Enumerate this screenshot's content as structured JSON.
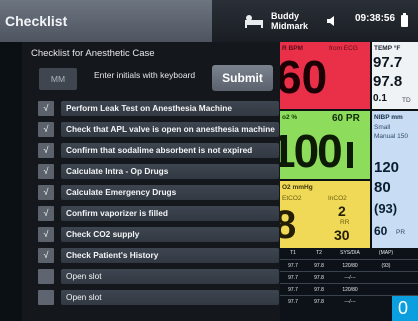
{
  "topbar": {
    "title": "Checklist",
    "patient_name": "Buddy",
    "patient_id": "Midmark",
    "time": "09:38:56",
    "icons": [
      "patient-icon",
      "speaker-icon",
      "battery-icon"
    ]
  },
  "checklist": {
    "heading": "Checklist for Anesthetic Case",
    "initials_placeholder": "MM",
    "initials_hint": "Enter initials with keyboard",
    "submit_label": "Submit",
    "check_mark": "√",
    "items": [
      {
        "label": "Perform Leak Test on Anesthesia Machine",
        "checked": true
      },
      {
        "label": "Check that APL valve is open on anesthesia machine",
        "checked": true
      },
      {
        "label": "Confirm that sodalime absorbent is not expired",
        "checked": true
      },
      {
        "label": "Calculate Intra - Op Drugs",
        "checked": true
      },
      {
        "label": "Calculate Emergency Drugs",
        "checked": true
      },
      {
        "label": "Confirm vaporizer is filled",
        "checked": true
      },
      {
        "label": "Check CO2 supply",
        "checked": true
      },
      {
        "label": "Check Patient's History",
        "checked": true
      },
      {
        "label": "Open slot",
        "checked": false
      },
      {
        "label": "Open slot",
        "checked": false
      }
    ]
  },
  "monitor": {
    "ecg": {
      "label": "R BPM",
      "source": "from ECG",
      "value": "60"
    },
    "spo2": {
      "label": "o2 %",
      "pulse": "60 PR",
      "value": "100"
    },
    "co2": {
      "label": "O2 mmHg",
      "etco2_label": "EtCO2",
      "inco2_label": "InCO2",
      "inco2_value": "2",
      "rr_label": "RR",
      "rr_value": "30",
      "value": "8"
    },
    "temp": {
      "label": "TEMP °F",
      "t1": "97.7",
      "t2": "97.8",
      "delta": "0.1",
      "td_label": "TD"
    },
    "nibp": {
      "label": "NIBP mm",
      "cuff": "Small",
      "mode": "Manual 150",
      "systolic": "120",
      "diastolic": "80",
      "mean": "(93)",
      "pr": "60",
      "pr_label": "PR"
    },
    "table": {
      "headers": [
        "T1",
        "T2",
        "SYS/DIA",
        "(MAP)"
      ],
      "rows": [
        [
          "97.7",
          "97.8",
          "120/80",
          "(93)"
        ],
        [
          "97.7",
          "97.8",
          "---/---",
          ""
        ],
        [
          "97.7",
          "97.8",
          "120/80",
          ""
        ],
        [
          "97.7",
          "97.8",
          "---/---",
          ""
        ]
      ]
    },
    "corner_button": "0"
  }
}
